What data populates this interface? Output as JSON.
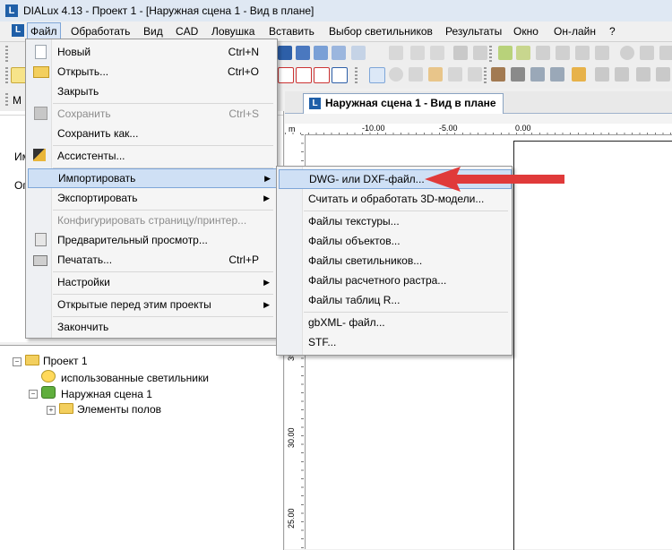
{
  "window": {
    "title": "DIALux 4.13 - Проект 1 - [Наружная сцена 1 - Вид в плане]",
    "app_icon": "L"
  },
  "menubar": {
    "items": [
      {
        "label": "Файл",
        "active": true
      },
      {
        "label": "Обработать"
      },
      {
        "label": "Вид"
      },
      {
        "label": "CAD"
      },
      {
        "label": "Ловушка"
      },
      {
        "label": "Вставить"
      },
      {
        "label": "Выбор светильников"
      },
      {
        "label": "Результаты"
      },
      {
        "label": "Окно"
      },
      {
        "label": "Он-лайн"
      },
      {
        "label": "?"
      }
    ]
  },
  "file_menu": {
    "items": [
      {
        "label": "Новый",
        "shortcut": "Ctrl+N",
        "icon": "new-document-icon"
      },
      {
        "label": "Открыть...",
        "shortcut": "Ctrl+O",
        "icon": "open-folder-icon"
      },
      {
        "label": "Закрыть",
        "shortcut": ""
      },
      {
        "label": "Сохранить",
        "shortcut": "Ctrl+S",
        "disabled": true,
        "icon": "save-icon"
      },
      {
        "label": "Сохранить как...",
        "shortcut": ""
      },
      {
        "label": "Ассистенты...",
        "shortcut": "",
        "icon": "wizard-icon"
      },
      {
        "label": "Импортировать",
        "submenu": true,
        "highlight": true
      },
      {
        "label": "Экспортировать",
        "submenu": true
      },
      {
        "label": "Конфигурировать страницу/принтер...",
        "disabled": true
      },
      {
        "label": "Предварительный просмотр...",
        "icon": "print-preview-icon"
      },
      {
        "label": "Печатать...",
        "shortcut": "Ctrl+P",
        "icon": "printer-icon"
      },
      {
        "label": "Настройки",
        "submenu": true
      },
      {
        "label": "Открытые перед этим проекты",
        "submenu": true
      },
      {
        "label": "Закончить"
      }
    ]
  },
  "import_submenu": {
    "items": [
      {
        "label": "DWG- или DXF-файл...",
        "highlight": true
      },
      {
        "label": "Считать и обработать 3D-модели..."
      },
      {
        "label": "Файлы текстуры..."
      },
      {
        "label": "Файлы объектов..."
      },
      {
        "label": "Файлы светильников..."
      },
      {
        "label": "Файлы расчетного растра..."
      },
      {
        "label": "Файлы таблиц R..."
      },
      {
        "label": "gbXML- файл..."
      },
      {
        "label": "STF..."
      }
    ]
  },
  "left_panel": {
    "label_1": "Им",
    "label_2": "Ог",
    "tab_label": "M"
  },
  "tree": {
    "items": [
      {
        "label": "Проект 1",
        "icon": "project-folder-icon",
        "expander": "−"
      },
      {
        "label": "использованные светильники",
        "icon": "luminaires-icon"
      },
      {
        "label": "Наружная сцена 1",
        "icon": "outdoor-scene-icon",
        "expander": "−"
      },
      {
        "label": "Элементы полов",
        "icon": "folder-icon",
        "expander": "+"
      }
    ]
  },
  "workspace": {
    "tab_title": "Наружная сцена 1 - Вид в плане",
    "ruler_unit": "m",
    "h_ticks": [
      "-10.00",
      "-5.00",
      "0.00"
    ],
    "v_ticks": [
      "35.00",
      "30.00",
      "25.00"
    ]
  },
  "colors": {
    "highlight": "#cfe0f5",
    "arrow": "#e03a3a",
    "accent": "#1f5fa8"
  }
}
